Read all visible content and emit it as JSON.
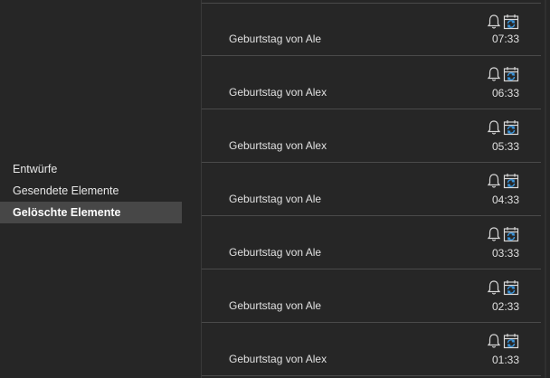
{
  "sidebar": {
    "folders": [
      {
        "label": "Entwürfe"
      },
      {
        "label": "Gesendete Elemente"
      },
      {
        "label": "Gelöschte Elemente"
      }
    ]
  },
  "messages": [
    {
      "subject": "Geburtstag von Ale",
      "time": "07:33"
    },
    {
      "subject": "Geburtstag von Alex",
      "time": "06:33"
    },
    {
      "subject": "Geburtstag von Alex",
      "time": "05:33"
    },
    {
      "subject": "Geburtstag von Ale",
      "time": "04:33"
    },
    {
      "subject": "Geburtstag von Ale",
      "time": "03:33"
    },
    {
      "subject": "Geburtstag von Ale",
      "time": "02:33"
    },
    {
      "subject": "Geburtstag von Alex",
      "time": "01:33"
    }
  ],
  "icons": {
    "reminder": "bell-icon",
    "recurring": "recurring-calendar-icon"
  },
  "colors": {
    "background": "#262626",
    "selected": "#474747",
    "divider": "#4a4a4a",
    "text": "#e0e0e0",
    "accent": "#3a96dd"
  }
}
